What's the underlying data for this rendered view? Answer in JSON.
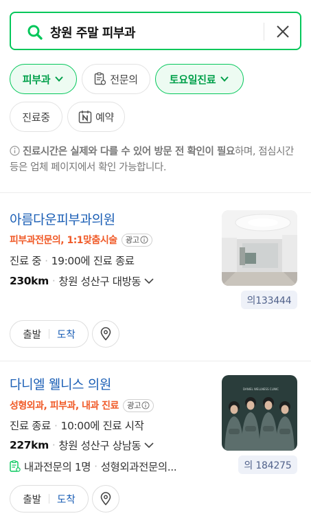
{
  "search": {
    "query": "창원 주말 피부과",
    "search_icon": "search-icon",
    "clear_icon": "close-icon"
  },
  "filters": [
    {
      "label": "피부과",
      "active": true,
      "icon": "chevron-down-icon"
    },
    {
      "label": "전문의",
      "active": false,
      "icon": "doctor-clipboard-icon"
    },
    {
      "label": "토요일진료",
      "active": true,
      "icon": "chevron-down-icon"
    },
    {
      "label": "진료중",
      "active": false
    },
    {
      "label": "예약",
      "active": false,
      "icon": "naver-booking-icon"
    }
  ],
  "notice": {
    "bold": "진료시간은 실제와 다를 수 있어 방문 전 확인이 필요",
    "rest": "하며, 점심시간 등은 업체 페이지에서 확인 가능합니다.",
    "icon": "info-icon"
  },
  "results": [
    {
      "name": "아름다운피부과의원",
      "tags": "피부과전문의, 1:1맞춤시술",
      "ad_label": "광고",
      "status": "진료 중",
      "status_detail": "19:00에 진료 종료",
      "distance": "230km",
      "address": "창원 성산구 대방동",
      "view_count": "의133444",
      "route_start": "출발",
      "route_arrive": "도착",
      "thumb": "clinic-interior-photo"
    },
    {
      "name": "다니엘 웰니스 의원",
      "tags": "성형외과, 피부과, 내과 진료",
      "ad_label": "광고",
      "status": "진료 종료",
      "status_detail": "10:00에 진료 시작",
      "distance": "227km",
      "address": "창원 성산구 상남동",
      "doctors_a": "내과전문의 1명",
      "doctors_b": "성형외과전문의...",
      "view_count": "의 184275",
      "route_start": "출발",
      "route_arrive": "도착",
      "thumb": "doctors-group-photo",
      "thumb_caption": "DANIEL WELLNESS CLINIC"
    }
  ],
  "colors": {
    "brand_green": "#03c75a",
    "link_blue": "#1a5eb5",
    "tag_orange": "#f05a28"
  }
}
